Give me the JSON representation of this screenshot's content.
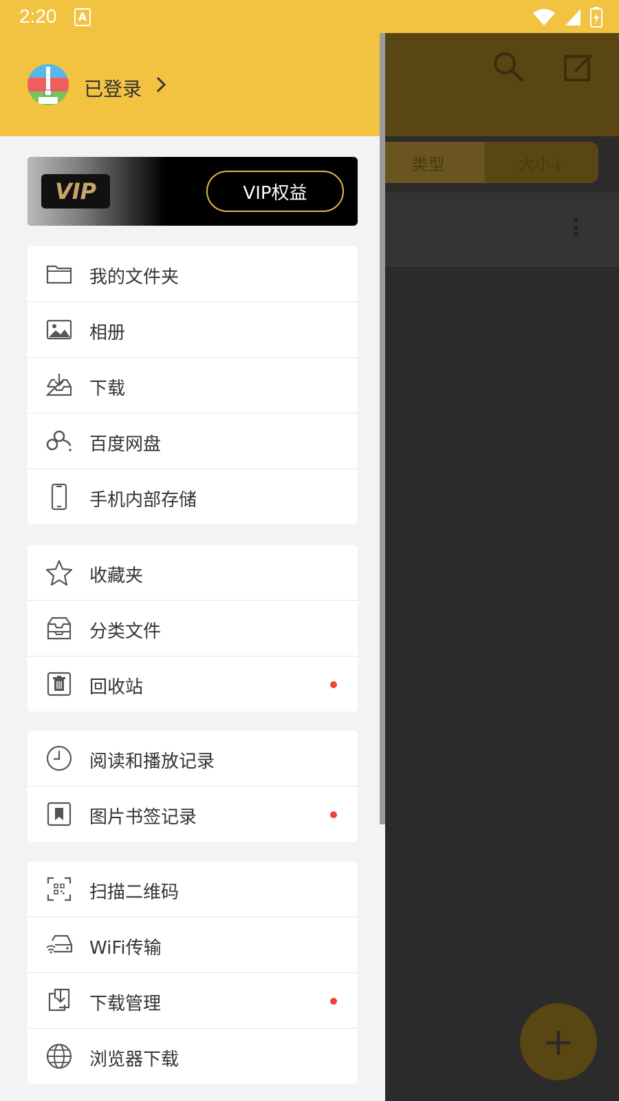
{
  "status_bar": {
    "time": "2:20",
    "notif_letter": "A"
  },
  "background": {
    "tabs": [
      "类型",
      "大小↓"
    ],
    "fab_label": "+"
  },
  "drawer": {
    "login_text": "已登录",
    "vip": {
      "badge": "VIP",
      "button": "VIP权益"
    },
    "groups": [
      {
        "items": [
          {
            "label": "我的文件夹",
            "icon": "folder-icon",
            "dot": false
          },
          {
            "label": "相册",
            "icon": "image-icon",
            "dot": false
          },
          {
            "label": "下载",
            "icon": "download-tray-icon",
            "dot": false
          },
          {
            "label": "百度网盘",
            "icon": "cloud-icon",
            "dot": false
          },
          {
            "label": "手机内部存储",
            "icon": "phone-icon",
            "dot": false
          }
        ]
      },
      {
        "items": [
          {
            "label": "收藏夹",
            "icon": "star-icon",
            "dot": false
          },
          {
            "label": "分类文件",
            "icon": "archive-box-icon",
            "dot": false
          },
          {
            "label": "回收站",
            "icon": "trash-icon",
            "dot": true
          }
        ]
      },
      {
        "items": [
          {
            "label": "阅读和播放记录",
            "icon": "clock-icon",
            "dot": false
          },
          {
            "label": "图片书签记录",
            "icon": "bookmark-icon",
            "dot": true
          }
        ]
      },
      {
        "items": [
          {
            "label": "扫描二维码",
            "icon": "qr-scan-icon",
            "dot": false
          },
          {
            "label": "WiFi传输",
            "icon": "wifi-drive-icon",
            "dot": false
          },
          {
            "label": "下载管理",
            "icon": "download-manage-icon",
            "dot": true
          },
          {
            "label": "浏览器下载",
            "icon": "globe-icon",
            "dot": false
          }
        ]
      }
    ]
  },
  "colors": {
    "accent": "#f2c341",
    "dot": "#f2403a",
    "vip_gold": "#e6b84a"
  }
}
